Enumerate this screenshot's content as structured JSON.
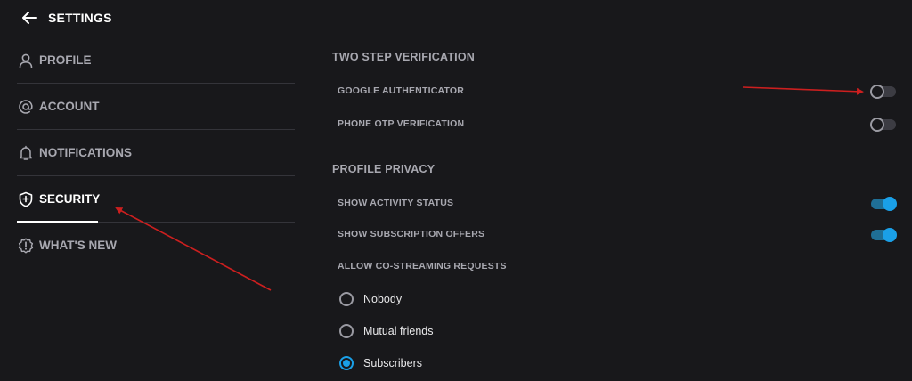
{
  "header": {
    "title": "SETTINGS",
    "back_icon": "arrow-left-icon"
  },
  "sidebar": {
    "items": [
      {
        "label": "PROFILE",
        "icon": "person-icon",
        "active": false
      },
      {
        "label": "ACCOUNT",
        "icon": "at-sign-icon",
        "active": false
      },
      {
        "label": "NOTIFICATIONS",
        "icon": "bell-icon",
        "active": false
      },
      {
        "label": "SECURITY",
        "icon": "shield-icon",
        "active": true
      },
      {
        "label": "WHAT'S NEW",
        "icon": "alert-badge-icon",
        "active": false
      }
    ]
  },
  "two_step": {
    "title": "TWO STEP VERIFICATION",
    "google_authenticator": {
      "label": "GOOGLE AUTHENTICATOR",
      "enabled": false
    },
    "phone_otp": {
      "label": "PHONE OTP VERIFICATION",
      "enabled": false
    }
  },
  "privacy": {
    "title": "PROFILE PRIVACY",
    "activity_status": {
      "label": "SHOW ACTIVITY STATUS",
      "enabled": true
    },
    "subscription_offers": {
      "label": "SHOW SUBSCRIPTION OFFERS",
      "enabled": true
    },
    "co_streaming": {
      "label": "ALLOW CO-STREAMING REQUESTS",
      "options": [
        "Nobody",
        "Mutual friends",
        "Subscribers"
      ],
      "selected": "Subscribers"
    }
  },
  "colors": {
    "background": "#18181b",
    "accent": "#1aa0e8",
    "muted_text": "#a8a8b0",
    "annotation_arrow": "#cc1f1f"
  }
}
